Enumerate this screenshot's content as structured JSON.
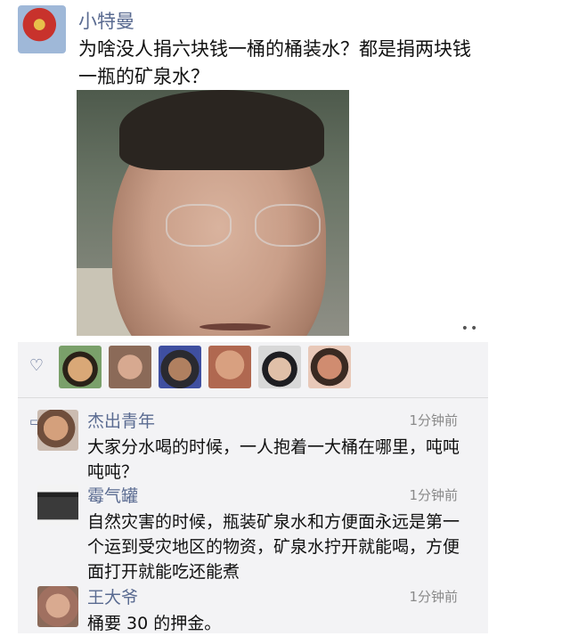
{
  "post": {
    "author": "小特曼",
    "text": "为啥没人捐六块钱一桶的桶装水？都是捐两块钱一瓶的矿泉水？",
    "more_icon": "••",
    "author_avatar_icon": "ultraman-icon"
  },
  "likes": {
    "icon": "heart-outline-icon",
    "count_shown": 6
  },
  "comments_icon": "comment-bubble-icon",
  "comments": [
    {
      "name": "杰出青年",
      "time": "1分钟前",
      "text": "大家分水喝的时候，一人抱着一大桶在哪里，吨吨吨吨？"
    },
    {
      "name": "霉气罐",
      "time": "1分钟前",
      "text": "自然灾害的时候，瓶装矿泉水和方便面永远是第一个运到受灾地区的物资，矿泉水拧开就能喝，方便面打开就能吃还能煮"
    },
    {
      "name": "王大爷",
      "time": "1分钟前",
      "text": "桶要 30 的押金。"
    }
  ],
  "colors": {
    "name_blue": "#5a6b91",
    "panel_bg": "#f3f3f5",
    "time_gray": "#8a8a8a"
  }
}
